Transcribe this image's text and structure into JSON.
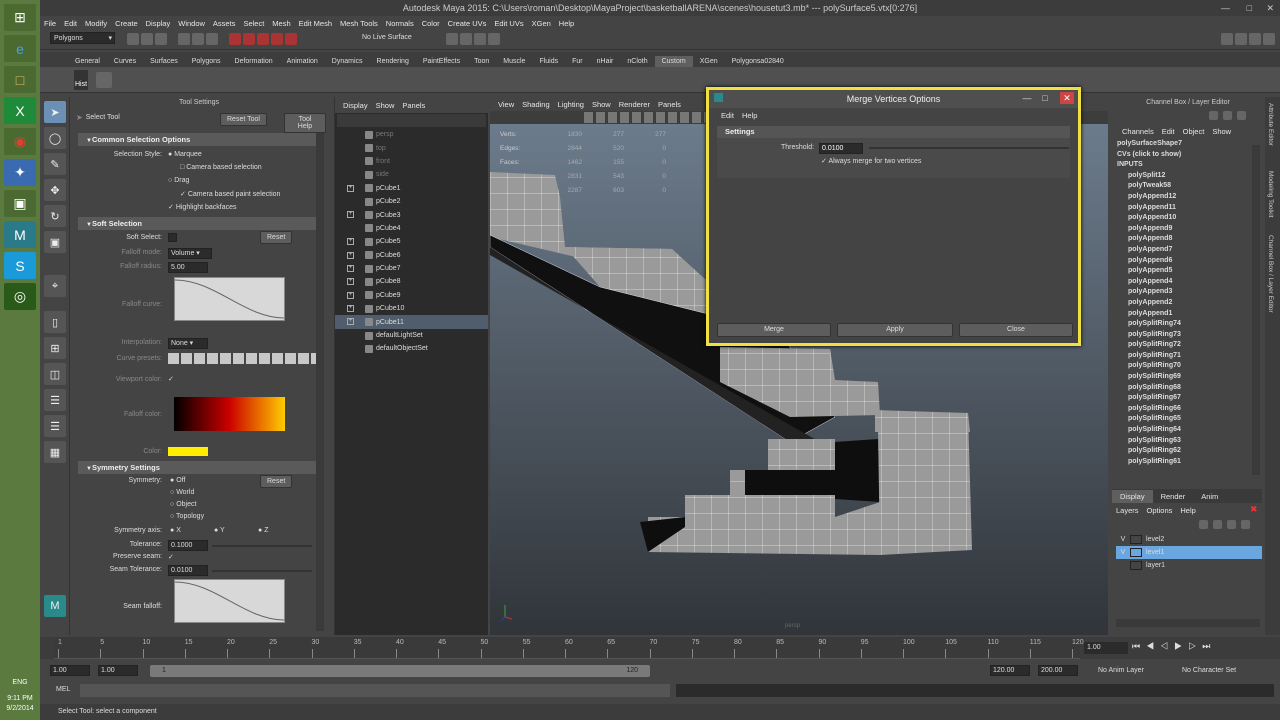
{
  "window": {
    "title": "Autodesk Maya 2015: C:\\Users\\roman\\Desktop\\MayaProject\\basketballARENA\\scenes\\housetut3.mb*   ---   polySurface5.vtx[0:276]"
  },
  "menu": [
    "File",
    "Edit",
    "Modify",
    "Create",
    "Display",
    "Window",
    "Assets",
    "Select",
    "Mesh",
    "Edit Mesh",
    "Mesh Tools",
    "Normals",
    "Color",
    "Create UVs",
    "Edit UVs",
    "XGen",
    "Help"
  ],
  "statusline": {
    "mode": "Polygons",
    "live_surface": "No Live Surface"
  },
  "shelf_tabs": [
    "General",
    "Curves",
    "Surfaces",
    "Polygons",
    "Deformation",
    "Animation",
    "Dynamics",
    "Rendering",
    "PaintEffects",
    "Toon",
    "Muscle",
    "Fluids",
    "Fur",
    "nHair",
    "nCloth",
    "Custom",
    "XGen",
    "Polygonsa02840"
  ],
  "shelf_active": "Custom",
  "shelf_items": {
    "hist": "Hist"
  },
  "tool_settings": {
    "header": "Tool Settings",
    "tool_name": "Select Tool",
    "reset_tool": "Reset Tool",
    "tool_help": "Tool Help",
    "common_section": "Common Selection Options",
    "selection_style": "Selection Style:",
    "marquee": "Marquee",
    "camera_based_selection": "Camera based selection",
    "drag": "Drag",
    "camera_based_paint": "Camera based paint selection",
    "highlight_backfaces": "Highlight backfaces",
    "soft_section": "Soft Selection",
    "soft_select": "Soft Select:",
    "reset": "Reset",
    "falloff_mode": "Falloff mode:",
    "falloff_mode_value": "Volume",
    "falloff_radius": "Falloff radius:",
    "falloff_radius_value": "5.00",
    "falloff_curve": "Falloff curve:",
    "interpolation": "Interpolation:",
    "interpolation_value": "None",
    "curve_presets": "Curve presets:",
    "viewport_color": "Viewport color:",
    "falloff_color": "Falloff color:",
    "color": "Color:",
    "sym_section": "Symmetry Settings",
    "symmetry": "Symmetry:",
    "sym_off": "Off",
    "sym_world": "World",
    "sym_object": "Object",
    "sym_topology": "Topology",
    "sym_axis": "Symmetry axis:",
    "axis_x": "X",
    "axis_y": "Y",
    "axis_z": "Z",
    "tolerance": "Tolerance:",
    "tolerance_value": "0.1000",
    "preserve_seam": "Preserve seam:",
    "seam_tolerance": "Seam Tolerance:",
    "seam_tolerance_value": "0.0100",
    "seam_falloff": "Seam falloff:"
  },
  "outliner": {
    "menu": [
      "Display",
      "Show",
      "Panels"
    ],
    "items": [
      {
        "label": "persp",
        "dim": true,
        "exp": false
      },
      {
        "label": "top",
        "dim": true,
        "exp": false
      },
      {
        "label": "front",
        "dim": true,
        "exp": false
      },
      {
        "label": "side",
        "dim": true,
        "exp": false
      },
      {
        "label": "pCube1",
        "dim": false,
        "exp": true
      },
      {
        "label": "pCube2",
        "dim": false,
        "exp": false
      },
      {
        "label": "pCube3",
        "dim": false,
        "exp": true
      },
      {
        "label": "pCube4",
        "dim": false,
        "exp": false
      },
      {
        "label": "pCube5",
        "dim": false,
        "exp": true
      },
      {
        "label": "pCube6",
        "dim": false,
        "exp": true
      },
      {
        "label": "pCube7",
        "dim": false,
        "exp": true
      },
      {
        "label": "pCube8",
        "dim": false,
        "exp": true
      },
      {
        "label": "pCube9",
        "dim": false,
        "exp": true
      },
      {
        "label": "pCube10",
        "dim": false,
        "exp": true
      },
      {
        "label": "pCube11",
        "dim": false,
        "exp": true,
        "sel": true
      },
      {
        "label": "defaultLightSet",
        "dim": false,
        "exp": false
      },
      {
        "label": "defaultObjectSet",
        "dim": false,
        "exp": false
      }
    ]
  },
  "viewport": {
    "menu": [
      "View",
      "Shading",
      "Lighting",
      "Show",
      "Renderer",
      "Panels"
    ],
    "hud": [
      {
        "k": "Verts:",
        "a": "1830",
        "b": "277",
        "c": "277"
      },
      {
        "k": "Edges:",
        "a": "2844",
        "b": "520",
        "c": "0"
      },
      {
        "k": "Faces:",
        "a": "1462",
        "b": "155",
        "c": "0"
      },
      {
        "k": "Tris:",
        "a": "2831",
        "b": "543",
        "c": "0"
      },
      {
        "k": "UVs:",
        "a": "2287",
        "b": "603",
        "c": "0"
      }
    ],
    "persp_label": "persp"
  },
  "dialog": {
    "title": "Merge Vertices Options",
    "menu": [
      "Edit",
      "Help"
    ],
    "settings": "Settings",
    "threshold_label": "Threshold:",
    "threshold_value": "0.0100",
    "always_merge": "Always merge for two vertices",
    "merge": "Merge",
    "apply": "Apply",
    "close": "Close"
  },
  "channel_box": {
    "header": "Channel Box / Layer Editor",
    "menu": [
      "Channels",
      "Edit",
      "Object",
      "Show"
    ],
    "object": "polySurfaceShape7",
    "cvs": "CVs (click to show)",
    "inputs": "INPUTS",
    "items": [
      "polySplit12",
      "polyTweak58",
      "polyAppend12",
      "polyAppend11",
      "polyAppend10",
      "polyAppend9",
      "polyAppend8",
      "polyAppend7",
      "polyAppend6",
      "polyAppend5",
      "polyAppend4",
      "polyAppend3",
      "polyAppend2",
      "polyAppend1",
      "polySplitRing74",
      "polySplitRing73",
      "polySplitRing72",
      "polySplitRing71",
      "polySplitRing70",
      "polySplitRing69",
      "polySplitRing68",
      "polySplitRing67",
      "polySplitRing66",
      "polySplitRing65",
      "polySplitRing64",
      "polySplitRing63",
      "polySplitRing62",
      "polySplitRing61"
    ],
    "layer_tabs": [
      "Display",
      "Render",
      "Anim"
    ],
    "layer_menu": [
      "Layers",
      "Options",
      "Help"
    ],
    "layers": [
      {
        "v": "V",
        "name": "level2",
        "sel": false
      },
      {
        "v": "V",
        "name": "level1",
        "sel": true
      },
      {
        "v": "",
        "name": "layer1",
        "sel": false
      }
    ]
  },
  "side_tabs": [
    "Attribute Editor",
    "Modeling Toolkit",
    "Channel Box / Layer Editor"
  ],
  "timeline": {
    "ticks": [
      "1",
      "5",
      "10",
      "15",
      "20",
      "25",
      "30",
      "35",
      "40",
      "45",
      "50",
      "55",
      "60",
      "65",
      "70",
      "75",
      "80",
      "85",
      "90",
      "95",
      "100",
      "105",
      "110",
      "115",
      "120"
    ],
    "current": "1.00"
  },
  "range": {
    "start": "1.00",
    "start2": "1.00",
    "slider_start": "1",
    "slider_end": "120",
    "end": "120.00",
    "end2": "200.00",
    "anim_layer": "No Anim Layer",
    "char_set": "No Character Set"
  },
  "cmdline": {
    "label": "MEL"
  },
  "helpline": {
    "text": "Select Tool: select a component"
  },
  "taskbar": {
    "lang": "ENG",
    "time": "9:11 PM",
    "date": "9/2/2014"
  }
}
